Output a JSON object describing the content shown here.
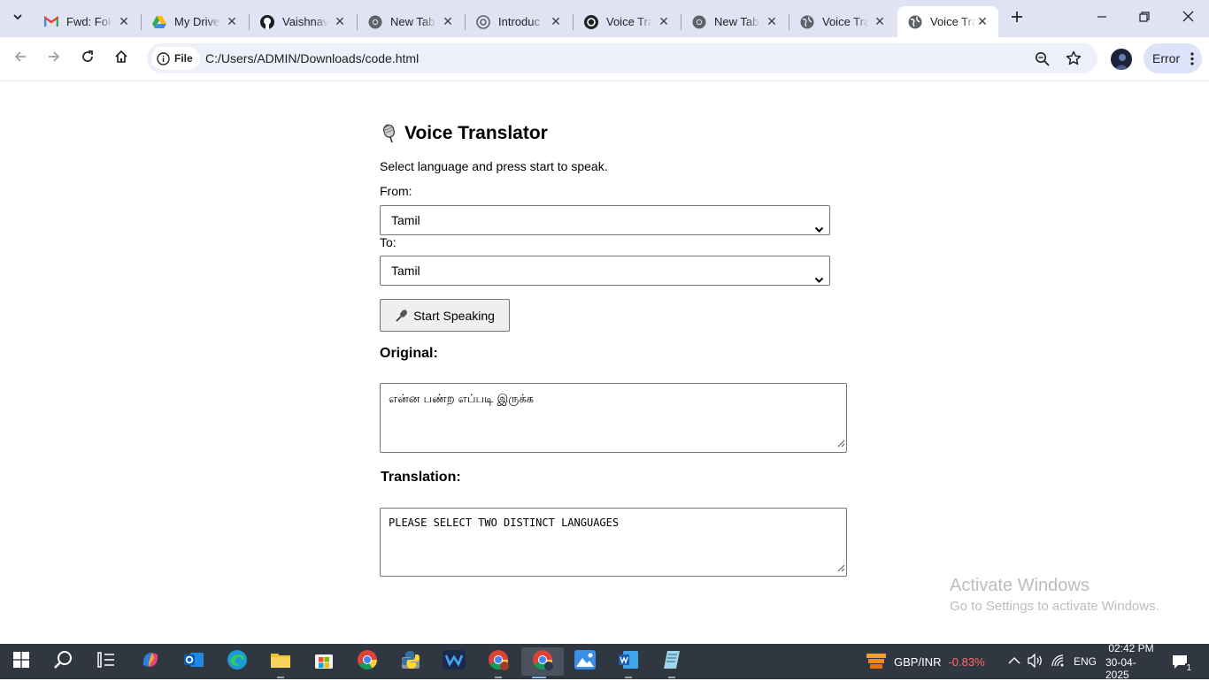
{
  "browser": {
    "tabs": [
      {
        "title": "Fwd: Fold",
        "icon": "gmail-icon"
      },
      {
        "title": "My Drive",
        "icon": "google-drive-icon"
      },
      {
        "title": "Vaishnav",
        "icon": "github-icon"
      },
      {
        "title": "New Tab",
        "icon": "chrome-icon"
      },
      {
        "title": "Introduc",
        "icon": "openai-icon"
      },
      {
        "title": "Voice Tra",
        "icon": "openai-icon"
      },
      {
        "title": "New Tab",
        "icon": "chrome-icon"
      },
      {
        "title": "Voice Tra",
        "icon": "globe-icon"
      },
      {
        "title": "Voice Tra",
        "icon": "globe-icon",
        "active": true
      }
    ],
    "site_chip": "File",
    "url": "C:/Users/ADMIN/Downloads/code.html",
    "error_label": "Error"
  },
  "page": {
    "title": "Voice Translator",
    "subtitle": "Select language and press start to speak.",
    "from_label": "From:",
    "from_value": "Tamil",
    "to_label": "To:",
    "to_value": "Tamil",
    "start_button": "Start Speaking",
    "original_label": "Original:",
    "original_text": "என்ன பண்ற எப்படி இருக்க",
    "translation_label": "Translation:",
    "translation_text": "PLEASE SELECT TWO DISTINCT LANGUAGES"
  },
  "watermark": {
    "line1": "Activate Windows",
    "line2": "Go to Settings to activate Windows."
  },
  "taskbar": {
    "ticker_pair": "GBP/INR",
    "ticker_change": "-0.83%",
    "language": "ENG",
    "time": "02:42 PM",
    "date": "30-04-2025",
    "notification_count": "1"
  },
  "colors": {
    "tabstrip": "#dfe3f4",
    "ticker_negative": "#ff6b6b",
    "taskbar": "#303741"
  }
}
